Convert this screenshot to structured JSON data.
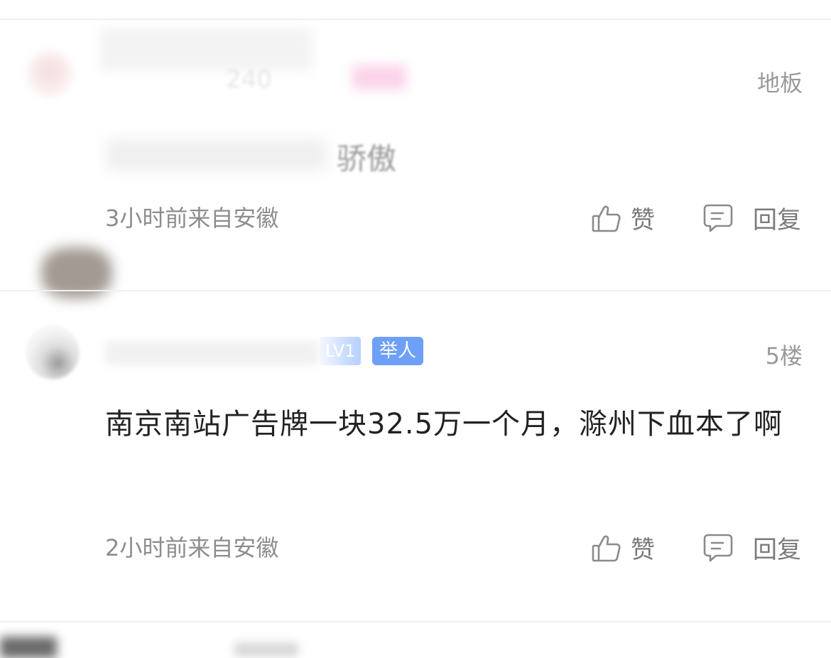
{
  "comments": [
    {
      "floor_label": "地板",
      "blurred_username": "240",
      "blurred_text": "骄傲",
      "meta": "3小时前来自安徽",
      "like_label": "赞",
      "reply_label": "回复"
    },
    {
      "floor_label": "5楼",
      "level_badge": "LV1",
      "tag_badge": "举人",
      "text": "南京南站广告牌一块32.5万一个月，滁州下血本了啊",
      "meta": "2小时前来自安徽",
      "like_label": "赞",
      "reply_label": "回复"
    }
  ],
  "colors": {
    "floor_text": "#9a9a9a",
    "meta_text": "#8d8d8d",
    "tag_badge": "#6ea0f7",
    "divider": "#f0f0f0"
  },
  "icons": [
    "thumbs-up-icon",
    "comment-icon"
  ]
}
